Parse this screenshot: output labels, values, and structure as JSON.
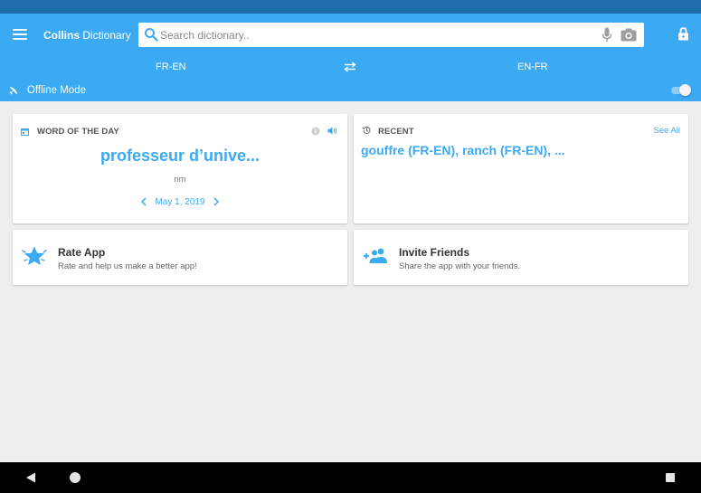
{
  "app": {
    "title_bold": "Collins",
    "title_rest": " Dictionary",
    "colors": {
      "primary": "#3baaf3",
      "status_bar": "#1f6ea9",
      "background": "#eeeeee"
    }
  },
  "search": {
    "placeholder": "Search dictionary..",
    "value": ""
  },
  "languages": {
    "left": "FR-EN",
    "right": "EN-FR"
  },
  "offline": {
    "label": "Offline Mode",
    "enabled": true
  },
  "word_of_the_day": {
    "heading": "WORD OF THE DAY",
    "word": "professeur d’unive...",
    "part_of_speech": "nm",
    "date": "May 1, 2019"
  },
  "recent": {
    "heading": "RECENT",
    "see_all": "See All",
    "items_text": "gouffre (FR-EN), ranch (FR-EN), ..."
  },
  "rate_app": {
    "title": "Rate App",
    "subtitle": "Rate and help us make a better app!"
  },
  "invite_friends": {
    "title": "Invite Friends",
    "subtitle": "Share the app with your friends."
  },
  "icons": {
    "menu": "menu-icon",
    "search": "search-icon",
    "mic": "microphone-icon",
    "camera": "camera-icon",
    "lock": "lock-icon",
    "swap": "swap-icon",
    "plane": "airplane-icon",
    "calendar": "calendar-icon",
    "info": "info-icon",
    "speaker": "speaker-icon",
    "history": "history-icon",
    "star": "star-icon",
    "people": "add-people-icon"
  }
}
